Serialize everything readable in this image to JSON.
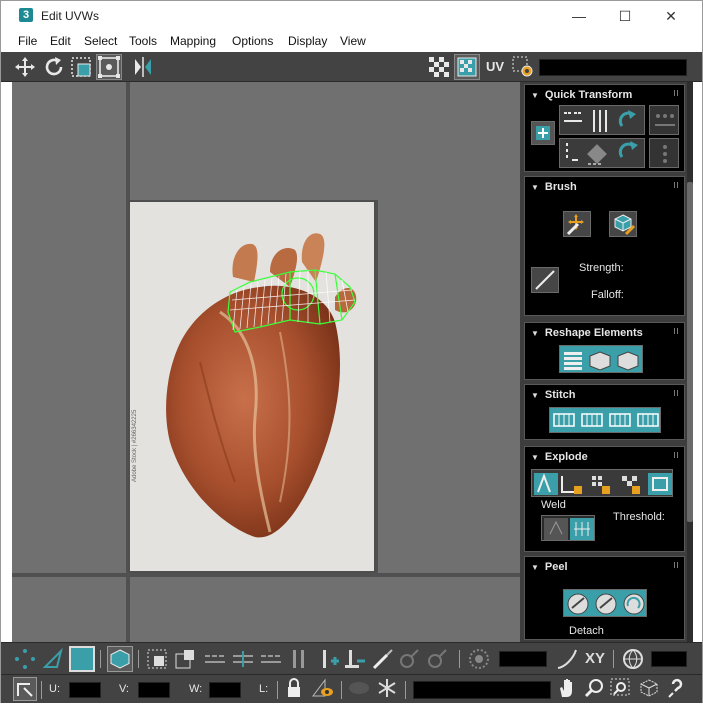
{
  "window": {
    "app_icon_text": "3",
    "title": "Edit UVWs",
    "minimize": "—",
    "maximize": "☐",
    "close": "✕"
  },
  "menu": [
    "File",
    "Edit",
    "Select",
    "Tools",
    "Mapping",
    "Options",
    "Display",
    "View"
  ],
  "toolbar": {
    "uv_label": "UV",
    "map_dropdown_value": ""
  },
  "viewport": {
    "watermark": "Adobe Stock | #266342225"
  },
  "panels": {
    "quick_transform": "Quick Transform",
    "brush": "Brush",
    "brush_strength": "Strength:",
    "brush_falloff": "Falloff:",
    "reshape": "Reshape Elements",
    "stitch": "Stitch",
    "explode": "Explode",
    "weld_label": "Weld",
    "threshold_label": "Threshold:",
    "peel": "Peel",
    "detach_label": "Detach"
  },
  "bottom": {
    "xy_label": "XY",
    "u_label": "U:",
    "v_label": "V:",
    "w_label": "W:",
    "l_label": "L:"
  },
  "colors": {
    "accent_teal": "#3a9fa8",
    "uv_wire_green": "#3aff3a",
    "panel_bg": "#000000",
    "toolbar_bg": "#434343",
    "viewport_bg": "#707070"
  }
}
